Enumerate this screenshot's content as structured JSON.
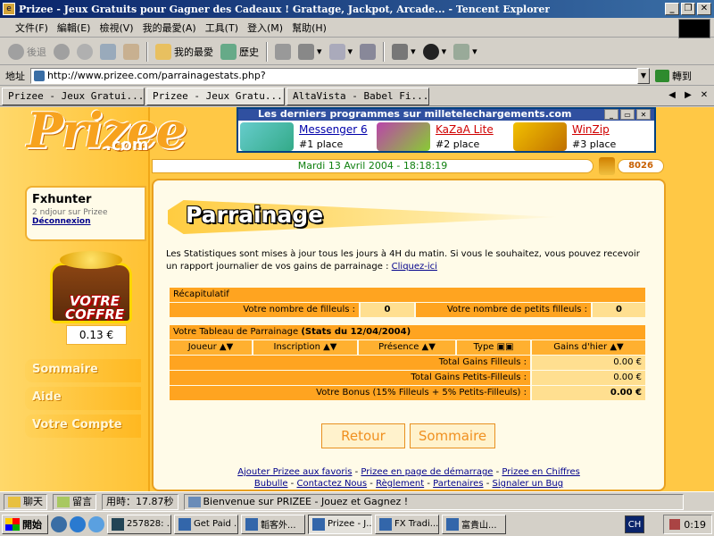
{
  "window": {
    "title": "Prizee - Jeux Gratuits pour Gagner des Cadeaux ! Grattage, Jackpot, Arcade... - Tencent Explorer",
    "buttons": [
      "_",
      "❐",
      "✕"
    ]
  },
  "menu": [
    "文件(F)",
    "編輯(E)",
    "檢視(V)",
    "我的最愛(A)",
    "工具(T)",
    "登入(M)",
    "幫助(H)"
  ],
  "toolbar": {
    "back": "後退",
    "favorites": "我的最愛",
    "history": "歷史"
  },
  "address": {
    "label": "地址",
    "url": "http://www.prizee.com/parrainagestats.php?",
    "go": "轉到"
  },
  "tabs": [
    {
      "label": "Prizee - Jeux Gratui..."
    },
    {
      "label": "Prizee - Jeux Gratu..."
    },
    {
      "label": "AltaVista - Babel Fi..."
    }
  ],
  "promo": {
    "header": "Les derniers programmes sur milletelechargements.com",
    "items": [
      {
        "name": "Messenger 6",
        "place": "#1 place",
        "color": "#0000aa"
      },
      {
        "name": "KaZaA Lite",
        "place": "#2 place",
        "color": "#d00000"
      },
      {
        "name": "WinZip",
        "place": "#3 place",
        "color": "#d00000"
      }
    ]
  },
  "logo": {
    "main": "Prizee",
    "sub": ".com"
  },
  "date_text": "Mardi 13 Avril 2004 - 18:18:19",
  "counter": "8026",
  "user": {
    "name": "Fxhunter",
    "rank": "2 ndjour sur Prizee",
    "logout": "Déconnexion"
  },
  "coffre": {
    "title": "VOTRE COFFRE",
    "amount": "0.13 €"
  },
  "nav": [
    "Sommaire",
    "Aide",
    "Votre Compte"
  ],
  "page": {
    "title": "Parrainage",
    "intro": "Les Statistiques sont mises à jour tous les jours à 4H du matin. Si vous le souhaitez, vous pouvez recevoir un rapport journalier de vos gains de parrainage :",
    "intro_link": "Cliquez-ici"
  },
  "recap": {
    "header": "Récapitulatif",
    "filleuls_label": "Votre nombre de filleuls :",
    "filleuls_value": "0",
    "petits_label": "Votre nombre de petits filleuls :",
    "petits_value": "0"
  },
  "tableau": {
    "title": "Votre Tableau de Parrainage",
    "stats": "(Stats du 12/04/2004)",
    "columns": [
      "Joueur",
      "Inscription",
      "Présence",
      "Type",
      "Gains d'hier"
    ],
    "totals": [
      {
        "label": "Total Gains Filleuls :",
        "value": "0.00 €"
      },
      {
        "label": "Total Gains Petits-Filleuls :",
        "value": "0.00 €"
      },
      {
        "label": "Votre Bonus (15% Filleuls + 5% Petits-Filleuls) :",
        "value": "0.00 €"
      }
    ]
  },
  "buttons": {
    "back": "Retour",
    "summary": "Sommaire"
  },
  "footer": {
    "links1": [
      "Ajouter Prizee aux favoris",
      "Prizee en page de démarrage",
      "Prizee en Chiffres"
    ],
    "links2": [
      "Bubulle",
      "Contactez Nous",
      "Règlement",
      "Partenaires",
      "Signaler un Bug"
    ]
  },
  "status": {
    "chat": "聊天",
    "msg": "留言",
    "time": "用時：17.87秒",
    "text": "Bienvenue sur PRIZEE - Jouez et Gagnez !"
  },
  "taskbar": {
    "start": "開始",
    "tasks": [
      "257828: ...",
      "Get Paid ...",
      "韜客外...",
      "Prizee - J...",
      "FX Tradi...",
      "富貴山..."
    ],
    "lang": "CH",
    "clock": "0:19"
  },
  "colors": {
    "accent": "#ffa420",
    "link": "#00008b",
    "date": "#108010"
  }
}
